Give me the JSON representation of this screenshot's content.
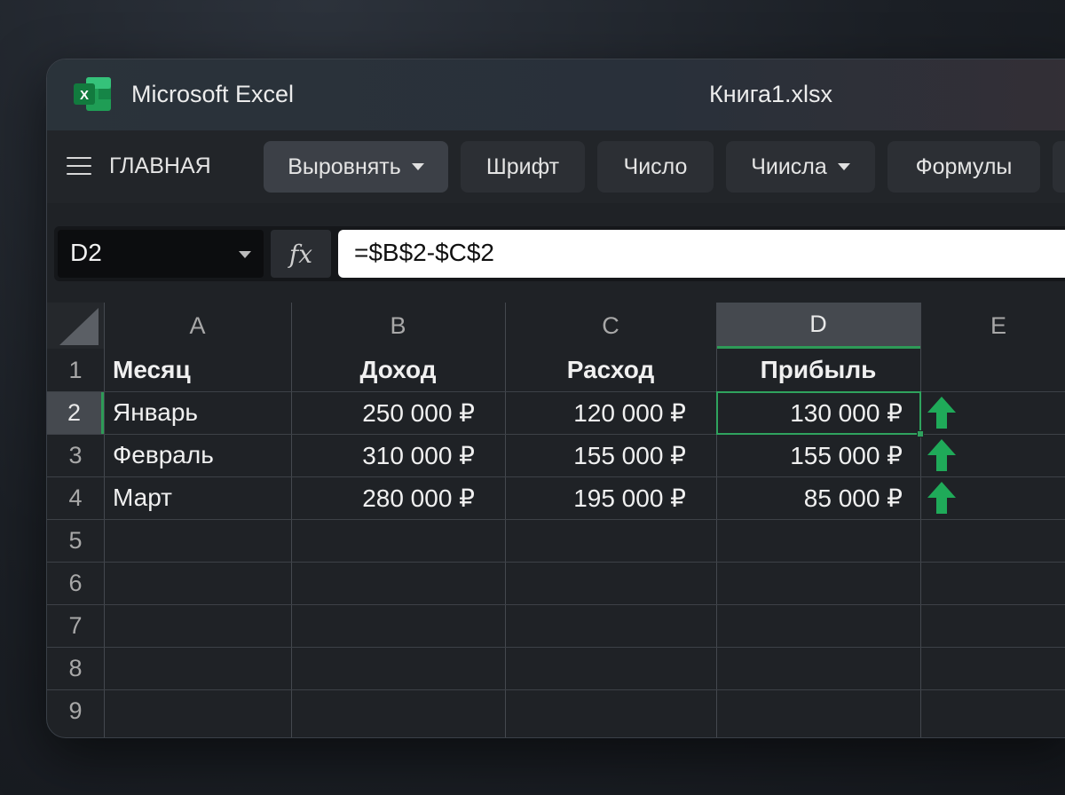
{
  "titlebar": {
    "app_title": "Microsoft Excel",
    "file_name": "Книга1.xlsx",
    "logo_letter": "X"
  },
  "ribbon": {
    "home_label": "ГЛАВНАЯ",
    "buttons": [
      "Выровнять",
      "Шрифт",
      "Число",
      "Чиисла",
      "Формулы"
    ]
  },
  "formula_bar": {
    "name_box": "D2",
    "fx_label": "fx",
    "formula": "=$B$2-$C$2"
  },
  "sheet": {
    "columns": [
      "A",
      "B",
      "C",
      "D",
      "E"
    ],
    "selected_column": "D",
    "rows": [
      "1",
      "2",
      "3",
      "4",
      "5",
      "6",
      "7",
      "8",
      "9"
    ],
    "selected_row": "2",
    "header": [
      "Месяц",
      "Доход",
      "Расход",
      "Прибыль"
    ],
    "data": [
      [
        "Январь",
        "250 000 ₽",
        "120 000 ₽",
        "130 000 ₽"
      ],
      [
        "Февраль",
        "310 000 ₽",
        "155 000 ₽",
        "155 000 ₽"
      ],
      [
        "Март",
        "280 000 ₽",
        "195 000 ₽",
        "85 000 ₽"
      ]
    ],
    "trend_icons": [
      "arrow-up-icon",
      "arrow-up-icon",
      "arrow-up-icon"
    ]
  },
  "colors": {
    "accent_green": "#2fa35e",
    "arrow_green": "#1faa59",
    "background": "#1f2226"
  }
}
